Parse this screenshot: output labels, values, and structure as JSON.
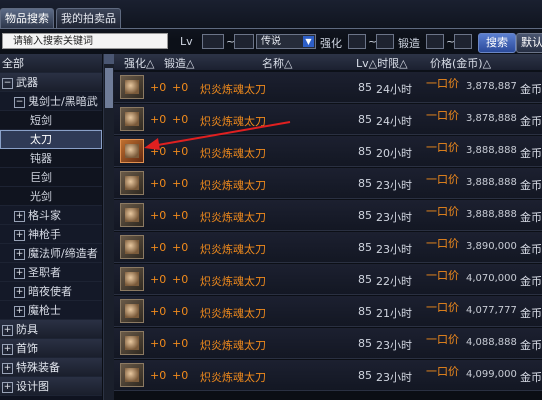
{
  "tabs": [
    "物品搜索",
    "我的拍卖品"
  ],
  "search": {
    "placeholder": "请输入搜索关键词",
    "lv_label": "Lv",
    "tilde": "~",
    "rarity_value": "传说",
    "qianghua_label": "强化",
    "duanzao_label": "锻造",
    "search_button": "搜索",
    "default_button": "默认"
  },
  "sidebar": [
    {
      "label": "全部",
      "level": 0,
      "toggle": ""
    },
    {
      "label": "武器",
      "level": 0,
      "toggle": "−"
    },
    {
      "label": "鬼剑士/黑暗武",
      "level": 1,
      "toggle": "−"
    },
    {
      "label": "短剑",
      "level": 2,
      "toggle": ""
    },
    {
      "label": "太刀",
      "level": 2,
      "toggle": "",
      "selected": true
    },
    {
      "label": "钝器",
      "level": 2,
      "toggle": ""
    },
    {
      "label": "巨剑",
      "level": 2,
      "toggle": ""
    },
    {
      "label": "光剑",
      "level": 2,
      "toggle": ""
    },
    {
      "label": "格斗家",
      "level": 1,
      "toggle": "+"
    },
    {
      "label": "神枪手",
      "level": 1,
      "toggle": "+"
    },
    {
      "label": "魔法师/缔造者",
      "level": 1,
      "toggle": "+"
    },
    {
      "label": "圣职者",
      "level": 1,
      "toggle": "+"
    },
    {
      "label": "暗夜使者",
      "level": 1,
      "toggle": "+"
    },
    {
      "label": "魔枪士",
      "level": 1,
      "toggle": "+"
    },
    {
      "label": "防具",
      "level": 0,
      "toggle": "+"
    },
    {
      "label": "首饰",
      "level": 0,
      "toggle": "+"
    },
    {
      "label": "特殊装备",
      "level": 0,
      "toggle": "+"
    },
    {
      "label": "设计图",
      "level": 0,
      "toggle": "+"
    }
  ],
  "columns": {
    "qianghua": "强化△",
    "duanzao": "锻造△",
    "name": "名称△",
    "lv_time": "Lv△时限△",
    "price": "价格(金币)△"
  },
  "rows": [
    {
      "q": "+0",
      "d": "+0",
      "name": "炽炎炼魂太刀",
      "lv": "85",
      "time": "24小时",
      "type": "一口价",
      "price": "3,878,887",
      "unit": "金币",
      "glow": false
    },
    {
      "q": "+0",
      "d": "+0",
      "name": "炽炎炼魂太刀",
      "lv": "85",
      "time": "24小时",
      "type": "一口价",
      "price": "3,878,888",
      "unit": "金币",
      "glow": false
    },
    {
      "q": "+0",
      "d": "+0",
      "name": "炽炎炼魂太刀",
      "lv": "85",
      "time": "20小时",
      "type": "一口价",
      "price": "3,888,888",
      "unit": "金币",
      "glow": true
    },
    {
      "q": "+0",
      "d": "+0",
      "name": "炽炎炼魂太刀",
      "lv": "85",
      "time": "23小时",
      "type": "一口价",
      "price": "3,888,888",
      "unit": "金币",
      "glow": false
    },
    {
      "q": "+0",
      "d": "+0",
      "name": "炽炎炼魂太刀",
      "lv": "85",
      "time": "23小时",
      "type": "一口价",
      "price": "3,888,888",
      "unit": "金币",
      "glow": false
    },
    {
      "q": "+0",
      "d": "+0",
      "name": "炽炎炼魂太刀",
      "lv": "85",
      "time": "23小时",
      "type": "一口价",
      "price": "3,890,000",
      "unit": "金币",
      "glow": false
    },
    {
      "q": "+0",
      "d": "+0",
      "name": "炽炎炼魂太刀",
      "lv": "85",
      "time": "22小时",
      "type": "一口价",
      "price": "4,070,000",
      "unit": "金币",
      "glow": false
    },
    {
      "q": "+0",
      "d": "+0",
      "name": "炽炎炼魂太刀",
      "lv": "85",
      "time": "21小时",
      "type": "一口价",
      "price": "4,077,777",
      "unit": "金币",
      "glow": false
    },
    {
      "q": "+0",
      "d": "+0",
      "name": "炽炎炼魂太刀",
      "lv": "85",
      "time": "23小时",
      "type": "一口价",
      "price": "4,088,888",
      "unit": "金币",
      "glow": false
    },
    {
      "q": "+0",
      "d": "+0",
      "name": "炽炎炼魂太刀",
      "lv": "85",
      "time": "23小时",
      "type": "一口价",
      "price": "4,099,000",
      "unit": "金币",
      "glow": false
    }
  ]
}
